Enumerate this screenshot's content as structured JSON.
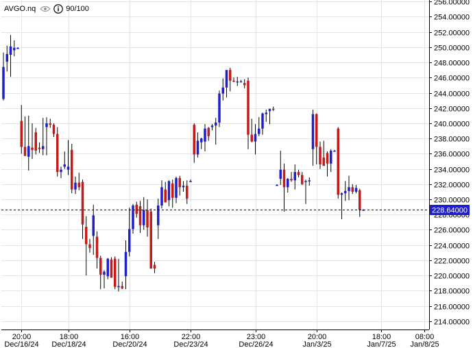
{
  "header": {
    "symbol": "AVGO.nq",
    "visibility_icon": "eye-icon",
    "info_icon": "info-icon",
    "quality": "90/100"
  },
  "colors": {
    "up": "#1f1fcc",
    "down": "#c41a1a",
    "wick": "#000000",
    "grid": "#e4e4e4",
    "price_tag": "#1f1fcc"
  },
  "chart_data": {
    "type": "candlestick",
    "ylim": [
      212.9,
      256.2
    ],
    "y_ticks": [
      "214.00000",
      "216.00000",
      "218.00000",
      "220.00000",
      "222.00000",
      "224.00000",
      "226.00000",
      "228.00000",
      "230.00000",
      "232.00000",
      "234.00000",
      "236.00000",
      "238.00000",
      "240.00000",
      "242.00000",
      "244.00000",
      "246.00000",
      "248.00000",
      "250.00000",
      "252.00000",
      "254.00000",
      "256.00000"
    ],
    "x_ticks": [
      {
        "time": "20:00",
        "date": "Dec/16/24",
        "index": 5
      },
      {
        "time": "18:00",
        "date": "Dec/18/24",
        "index": 18
      },
      {
        "time": "16:00",
        "date": "Dec/20/24",
        "index": 35
      },
      {
        "time": "22:00",
        "date": "Dec/23/24",
        "index": 52
      },
      {
        "time": "23:00",
        "date": "Dec/26/24",
        "index": 70
      },
      {
        "time": "20:00",
        "date": "Jan/3/25",
        "index": 87
      },
      {
        "time": "18:00",
        "date": "Jan/7/25",
        "index": 105
      },
      {
        "time": "08:00",
        "date": "Jan/8/25",
        "index": 117
      }
    ],
    "last_price": "228.64000",
    "last_value": 228.64,
    "candles": [
      {
        "o": 243.2,
        "h": 249.3,
        "l": 243.0,
        "c": 247.4
      },
      {
        "o": 248.1,
        "h": 250.2,
        "l": 246.8,
        "c": 249.1
      },
      {
        "o": 249.0,
        "h": 251.6,
        "l": 246.1,
        "c": 250.1
      },
      {
        "o": 249.6,
        "h": 250.9,
        "l": 248.8,
        "c": 249.9
      },
      {
        "o": 249.9,
        "h": 250.0,
        "l": 249.8,
        "c": 249.9
      },
      {
        "o": 240.3,
        "h": 242.4,
        "l": 236.0,
        "c": 236.9
      },
      {
        "o": 236.9,
        "h": 240.9,
        "l": 235.9,
        "c": 235.7
      },
      {
        "o": 235.6,
        "h": 241.0,
        "l": 233.8,
        "c": 237.0
      },
      {
        "o": 236.8,
        "h": 240.0,
        "l": 235.3,
        "c": 236.5
      },
      {
        "o": 238.8,
        "h": 239.4,
        "l": 235.9,
        "c": 236.4
      },
      {
        "o": 236.8,
        "h": 237.5,
        "l": 236.1,
        "c": 236.6
      },
      {
        "o": 236.6,
        "h": 240.7,
        "l": 235.8,
        "c": 237.0
      },
      {
        "o": 239.5,
        "h": 240.8,
        "l": 235.8,
        "c": 240.0
      },
      {
        "o": 240.0,
        "h": 240.6,
        "l": 239.4,
        "c": 239.8
      },
      {
        "o": 239.8,
        "h": 240.0,
        "l": 238.2,
        "c": 238.6
      },
      {
        "o": 238.6,
        "h": 239.5,
        "l": 233.0,
        "c": 233.6
      },
      {
        "o": 233.6,
        "h": 234.3,
        "l": 232.8,
        "c": 233.9
      },
      {
        "o": 234.3,
        "h": 236.3,
        "l": 234.0,
        "c": 234.6
      },
      {
        "o": 233.9,
        "h": 237.8,
        "l": 233.2,
        "c": 234.3
      },
      {
        "o": 236.5,
        "h": 237.3,
        "l": 230.8,
        "c": 231.3
      },
      {
        "o": 231.3,
        "h": 233.0,
        "l": 230.7,
        "c": 232.2
      },
      {
        "o": 232.2,
        "h": 233.5,
        "l": 231.2,
        "c": 231.6
      },
      {
        "o": 232.3,
        "h": 232.6,
        "l": 224.8,
        "c": 226.7
      },
      {
        "o": 226.4,
        "h": 227.8,
        "l": 220.0,
        "c": 224.1
      },
      {
        "o": 224.1,
        "h": 224.8,
        "l": 223.0,
        "c": 223.6
      },
      {
        "o": 225.2,
        "h": 229.3,
        "l": 222.7,
        "c": 227.9
      },
      {
        "o": 225.1,
        "h": 225.8,
        "l": 220.9,
        "c": 222.3
      },
      {
        "o": 222.3,
        "h": 222.6,
        "l": 218.2,
        "c": 220.1
      },
      {
        "o": 220.1,
        "h": 220.7,
        "l": 218.3,
        "c": 220.5
      },
      {
        "o": 219.9,
        "h": 222.3,
        "l": 219.5,
        "c": 222.2
      },
      {
        "o": 222.1,
        "h": 222.4,
        "l": 220.5,
        "c": 219.7
      },
      {
        "o": 222.2,
        "h": 222.5,
        "l": 218.2,
        "c": 218.5
      },
      {
        "o": 218.5,
        "h": 222.2,
        "l": 217.9,
        "c": 218.6
      },
      {
        "o": 218.6,
        "h": 219.2,
        "l": 218.2,
        "c": 218.3
      },
      {
        "o": 219.9,
        "h": 224.6,
        "l": 218.2,
        "c": 223.1
      },
      {
        "o": 223.1,
        "h": 228.9,
        "l": 222.5,
        "c": 226.1
      },
      {
        "o": 226.1,
        "h": 229.4,
        "l": 225.5,
        "c": 229.2
      },
      {
        "o": 229.3,
        "h": 229.7,
        "l": 227.6,
        "c": 228.1
      },
      {
        "o": 229.1,
        "h": 229.8,
        "l": 225.6,
        "c": 226.6
      },
      {
        "o": 226.6,
        "h": 230.3,
        "l": 226.0,
        "c": 228.6
      },
      {
        "o": 228.6,
        "h": 230.0,
        "l": 225.1,
        "c": 226.3
      },
      {
        "o": 228.4,
        "h": 228.8,
        "l": 221.3,
        "c": 220.9
      },
      {
        "o": 221.4,
        "h": 221.8,
        "l": 220.3,
        "c": 220.9
      },
      {
        "o": 226.6,
        "h": 230.1,
        "l": 224.8,
        "c": 229.2
      },
      {
        "o": 229.2,
        "h": 232.5,
        "l": 228.8,
        "c": 231.6
      },
      {
        "o": 231.3,
        "h": 232.3,
        "l": 229.9,
        "c": 229.6
      },
      {
        "o": 229.9,
        "h": 232.5,
        "l": 229.1,
        "c": 232.4
      },
      {
        "o": 232.1,
        "h": 232.6,
        "l": 228.9,
        "c": 230.2
      },
      {
        "o": 230.2,
        "h": 233.0,
        "l": 229.5,
        "c": 232.8
      },
      {
        "o": 232.8,
        "h": 233.1,
        "l": 230.5,
        "c": 231.6
      },
      {
        "o": 231.6,
        "h": 232.4,
        "l": 231.0,
        "c": 231.8
      },
      {
        "o": 231.8,
        "h": 232.5,
        "l": 229.4,
        "c": 230.1
      },
      {
        "o": 232.4,
        "h": 232.6,
        "l": 232.3,
        "c": 232.4
      },
      {
        "o": 239.8,
        "h": 240.0,
        "l": 234.8,
        "c": 235.9
      },
      {
        "o": 235.9,
        "h": 238.8,
        "l": 235.5,
        "c": 237.7
      },
      {
        "o": 237.5,
        "h": 238.1,
        "l": 236.6,
        "c": 238.0
      },
      {
        "o": 237.6,
        "h": 239.9,
        "l": 236.3,
        "c": 239.3
      },
      {
        "o": 239.4,
        "h": 239.5,
        "l": 237.7,
        "c": 238.3
      },
      {
        "o": 239.5,
        "h": 239.9,
        "l": 239.1,
        "c": 239.7
      },
      {
        "o": 239.7,
        "h": 240.7,
        "l": 237.2,
        "c": 240.1
      },
      {
        "o": 240.1,
        "h": 244.3,
        "l": 239.5,
        "c": 243.9
      },
      {
        "o": 243.9,
        "h": 245.9,
        "l": 243.0,
        "c": 244.7
      },
      {
        "o": 244.7,
        "h": 247.0,
        "l": 243.4,
        "c": 247.0
      },
      {
        "o": 247.0,
        "h": 247.3,
        "l": 244.2,
        "c": 245.6
      },
      {
        "o": 245.6,
        "h": 246.0,
        "l": 245.4,
        "c": 245.5
      },
      {
        "o": 245.5,
        "h": 246.1,
        "l": 244.9,
        "c": 245.5
      },
      {
        "o": 245.5,
        "h": 245.7,
        "l": 245.4,
        "c": 245.5
      },
      {
        "o": 245.3,
        "h": 245.8,
        "l": 244.6,
        "c": 245.0
      },
      {
        "o": 245.6,
        "h": 246.0,
        "l": 236.6,
        "c": 238.5
      },
      {
        "o": 238.5,
        "h": 240.6,
        "l": 237.5,
        "c": 237.6
      },
      {
        "o": 237.6,
        "h": 239.9,
        "l": 235.9,
        "c": 238.6
      },
      {
        "o": 238.6,
        "h": 240.8,
        "l": 238.3,
        "c": 239.3
      },
      {
        "o": 239.3,
        "h": 241.4,
        "l": 238.5,
        "c": 241.3
      },
      {
        "o": 241.2,
        "h": 241.8,
        "l": 240.2,
        "c": 241.4
      },
      {
        "o": 241.6,
        "h": 241.9,
        "l": 239.9,
        "c": 241.9
      },
      {
        "o": 241.9,
        "h": 242.2,
        "l": 241.6,
        "c": 241.8
      },
      {
        "o": 231.9,
        "h": 232.0,
        "l": 231.8,
        "c": 231.9
      },
      {
        "o": 232.7,
        "h": 236.4,
        "l": 231.9,
        "c": 233.9
      },
      {
        "o": 233.9,
        "h": 234.7,
        "l": 228.4,
        "c": 231.6
      },
      {
        "o": 231.6,
        "h": 232.8,
        "l": 230.9,
        "c": 232.7
      },
      {
        "o": 232.7,
        "h": 233.6,
        "l": 232.3,
        "c": 232.5
      },
      {
        "o": 232.5,
        "h": 234.6,
        "l": 231.3,
        "c": 233.6
      },
      {
        "o": 233.6,
        "h": 233.9,
        "l": 232.9,
        "c": 233.2
      },
      {
        "o": 233.2,
        "h": 233.6,
        "l": 231.9,
        "c": 232.0
      },
      {
        "o": 232.4,
        "h": 232.6,
        "l": 229.4,
        "c": 232.4
      },
      {
        "o": 232.5,
        "h": 232.9,
        "l": 231.8,
        "c": 232.5
      },
      {
        "o": 236.6,
        "h": 241.8,
        "l": 234.4,
        "c": 241.2
      },
      {
        "o": 241.2,
        "h": 241.3,
        "l": 234.6,
        "c": 236.9
      },
      {
        "o": 236.9,
        "h": 237.6,
        "l": 234.0,
        "c": 234.6
      },
      {
        "o": 235.5,
        "h": 237.7,
        "l": 234.5,
        "c": 234.4
      },
      {
        "o": 236.1,
        "h": 236.3,
        "l": 233.0,
        "c": 234.7
      },
      {
        "o": 234.7,
        "h": 236.6,
        "l": 233.6,
        "c": 236.4
      },
      {
        "o": 236.4,
        "h": 236.5,
        "l": 236.3,
        "c": 236.4
      },
      {
        "o": 239.3,
        "h": 239.5,
        "l": 230.1,
        "c": 230.6
      },
      {
        "o": 230.6,
        "h": 230.9,
        "l": 227.4,
        "c": 230.8
      },
      {
        "o": 230.8,
        "h": 232.4,
        "l": 229.8,
        "c": 231.1
      },
      {
        "o": 231.1,
        "h": 233.1,
        "l": 229.9,
        "c": 231.6
      },
      {
        "o": 231.6,
        "h": 232.0,
        "l": 230.7,
        "c": 231.0
      },
      {
        "o": 231.0,
        "h": 231.9,
        "l": 230.8,
        "c": 231.5
      },
      {
        "o": 231.2,
        "h": 231.4,
        "l": 227.7,
        "c": 228.6
      },
      {
        "o": 228.6,
        "h": 228.7,
        "l": 228.5,
        "c": 228.64
      }
    ]
  }
}
